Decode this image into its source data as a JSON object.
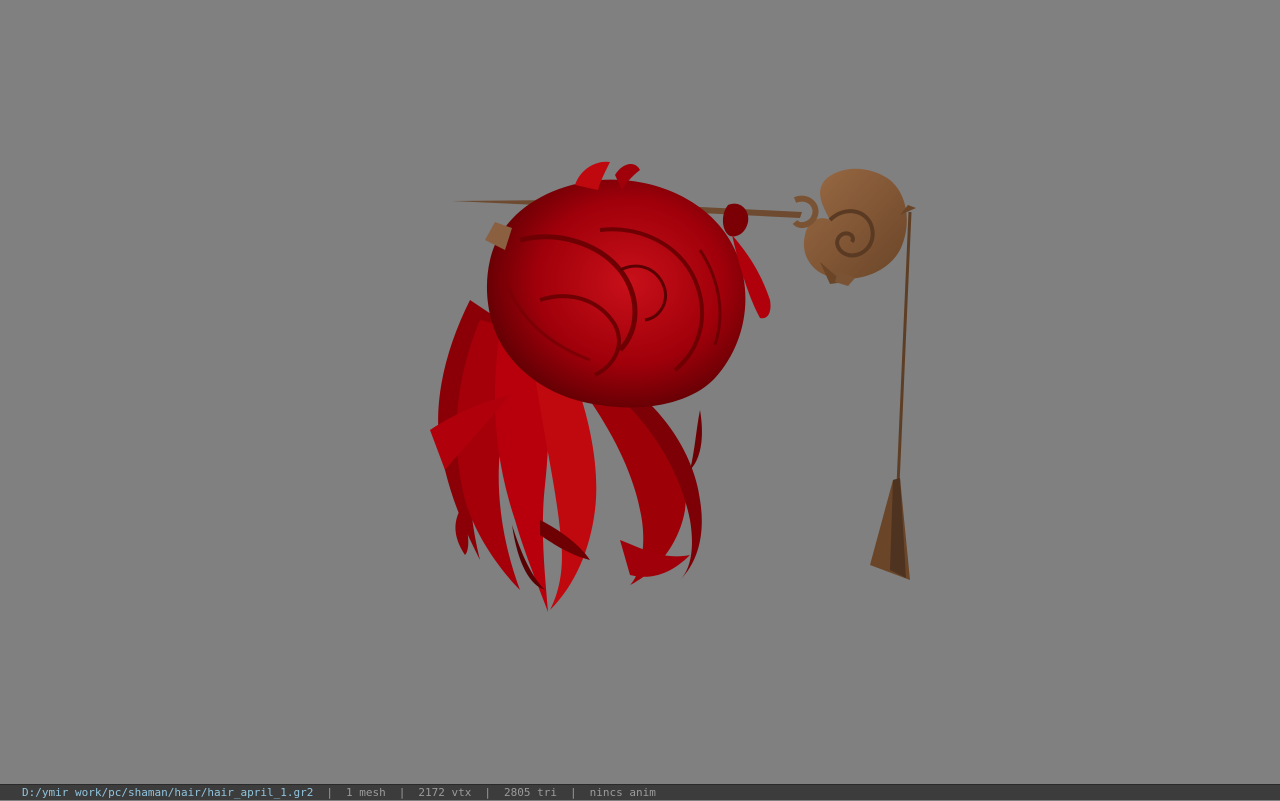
{
  "status_bar": {
    "file_path": "D:/ymir work/pc/shaman/hair/hair_april_1.gr2",
    "separator": "|",
    "mesh_count": "1 mesh",
    "vertex_count": "2172 vtx",
    "triangle_count": "2805 tri",
    "anim_status": "nincs anim"
  },
  "viewport": {
    "background_color": "#808080",
    "model": {
      "hair_color": "#b00008",
      "hair_shadow_color": "#6e0004",
      "staff_color": "#7a5334"
    }
  }
}
